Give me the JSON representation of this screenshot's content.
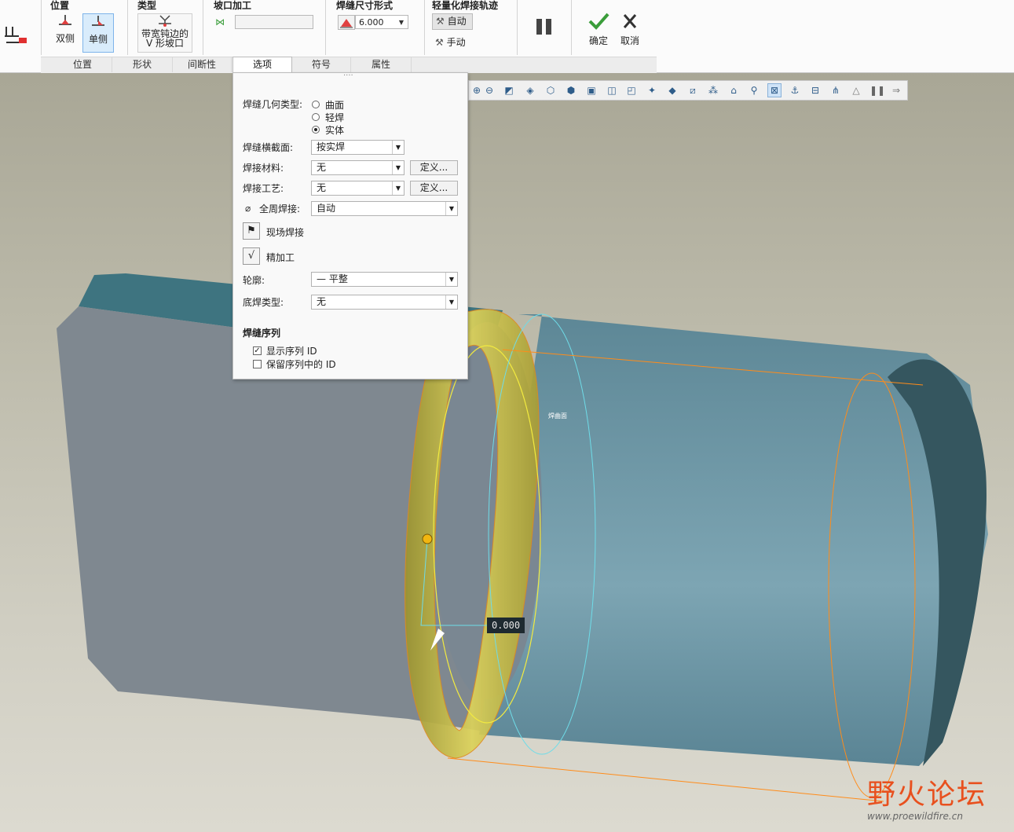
{
  "ribbon": {
    "groups": {
      "position": {
        "title": "位置",
        "both_label": "双侧",
        "single_label": "单侧"
      },
      "type": {
        "title": "类型",
        "line1": "带宽钝边的",
        "line2": "V 形坡口"
      },
      "groove": {
        "title": "坡口加工",
        "value": ""
      },
      "size_form": {
        "title": "焊缝尺寸形式",
        "value": "6.000"
      },
      "lightweight": {
        "title": "轻量化焊接轨迹",
        "auto_label": "自动",
        "manual_label": "手动"
      },
      "confirm_label": "确定",
      "cancel_label": "取消"
    },
    "tabs": [
      "位置",
      "形状",
      "间断性",
      "选项",
      "符号",
      "属性"
    ],
    "active_tab": "选项"
  },
  "options_panel": {
    "grip": "····",
    "geom_type_label": "焊缝几何类型:",
    "geom_types": [
      "曲面",
      "轻焊",
      "实体"
    ],
    "geom_selected": "实体",
    "cross_section_label": "焊缝横截面:",
    "cross_section_value": "按实焊",
    "material_label": "焊接材料:",
    "material_value": "无",
    "process_label": "焊接工艺:",
    "process_value": "无",
    "define_label": "定义...",
    "all_around_label": "全周焊接:",
    "all_around_value": "自动",
    "field_weld_label": "现场焊接",
    "finish_label": "精加工",
    "contour_label": "轮廓:",
    "contour_value": "平整",
    "backing_label": "底焊类型:",
    "backing_value": "无",
    "sequence_title": "焊缝序列",
    "show_seq_label": "显示序列 ID",
    "show_seq_checked": true,
    "keep_seq_label": "保留序列中的 ID",
    "keep_seq_checked": false
  },
  "viewport": {
    "dimension_value": "0.000",
    "weld_surface_label": "焊曲面",
    "watermark_cn": "野火论坛",
    "watermark_url": "www.proewildfire.cn"
  },
  "colors": {
    "accent_blue": "#7eb4ea",
    "confirm_green": "#3a9d3a",
    "weld_yellow": "#d8d04a",
    "pipe_teal": "#6e98a6",
    "plate_gray": "#7f8890",
    "edge_orange": "#ff8c1a"
  }
}
